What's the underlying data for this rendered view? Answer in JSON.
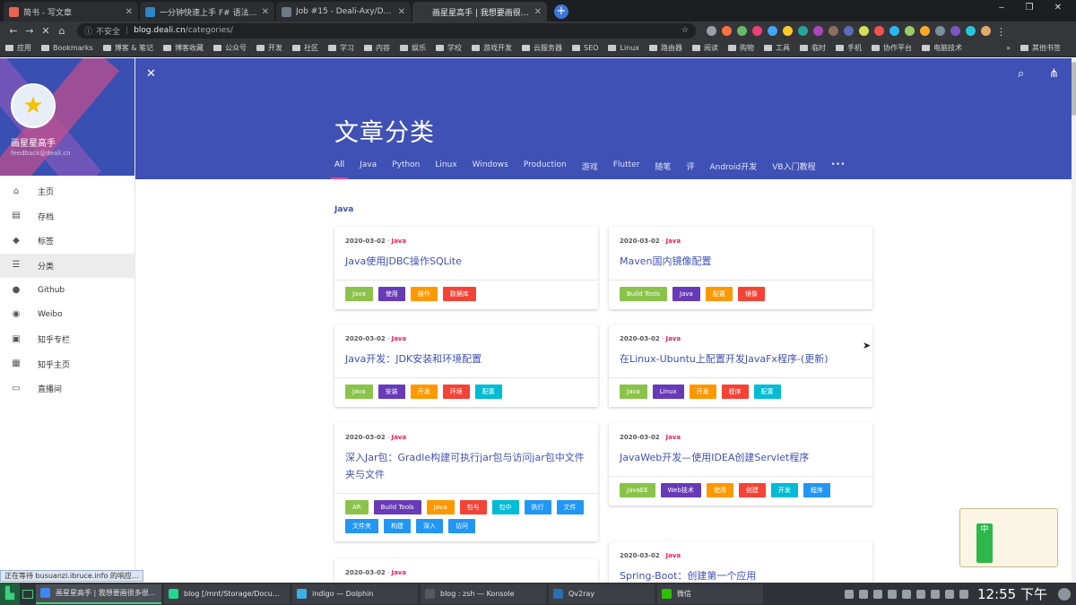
{
  "browser": {
    "tabs": [
      {
        "label": "简书 - 写文章",
        "icon": "jianshu-icon",
        "color": "#e9644f",
        "active": false
      },
      {
        "label": "一分钟快速上手 F# 语法 - 网上",
        "icon": "code-icon",
        "color": "#2d86c7",
        "active": false
      },
      {
        "label": "Job #15 - Deali-Axy/DealiAxy",
        "icon": "github-icon",
        "color": "#6c7a89",
        "active": false
      },
      {
        "label": "画星星高手 | 我想要画很多很",
        "icon": "blank-icon",
        "color": "#35363a",
        "active": true
      }
    ],
    "new_tab": "+",
    "window_controls": "‒ ❐ ✕",
    "address": {
      "insecure_label": "不安全",
      "host": "blog.deali.cn",
      "path": "/categories/"
    },
    "bookmarks": [
      "应用",
      "Bookmarks",
      "博客 & 笔记",
      "博客收藏",
      "公众号",
      "开发",
      "社区",
      "学习",
      "内容",
      "娱乐",
      "学校",
      "游戏开发",
      "云服务器",
      "SEO",
      "Linux",
      "路由器",
      "阅读",
      "购物",
      "工具",
      "临时",
      "手机",
      "协作平台",
      "电脑技术"
    ],
    "bookmarks_more": "»",
    "bookmarks_other": "其他书签"
  },
  "sidebar": {
    "name": "画星星高手",
    "email": "feedback@deali.cn",
    "menu": [
      {
        "label": "主页",
        "icon": "home-icon",
        "glyph": "⌂"
      },
      {
        "label": "存档",
        "icon": "archive-icon",
        "glyph": "▤"
      },
      {
        "label": "标签",
        "icon": "tag-icon",
        "glyph": "◆"
      },
      {
        "label": "分类",
        "icon": "list-icon",
        "glyph": "☰"
      },
      {
        "label": "Github",
        "icon": "github-icon",
        "glyph": "●"
      },
      {
        "label": "Weibo",
        "icon": "weibo-icon",
        "glyph": "◉"
      },
      {
        "label": "知乎专栏",
        "icon": "zhihu-column-icon",
        "glyph": "▣"
      },
      {
        "label": "知乎主页",
        "icon": "zhihu-profile-icon",
        "glyph": "▦"
      },
      {
        "label": "直播间",
        "icon": "monitor-icon",
        "glyph": "▭"
      }
    ],
    "active_index": 3
  },
  "header": {
    "close_glyph": "✕",
    "search_glyph": "⌕",
    "share_glyph": "⋔",
    "title": "文章分类",
    "tabs": [
      "All",
      "Java",
      "Python",
      "Linux",
      "Windows",
      "Production",
      "游戏",
      "Flutter",
      "随笔",
      "评",
      "Android开发",
      "VB入门教程",
      "•••"
    ],
    "active_tab": 0
  },
  "section": "Java",
  "posts": [
    {
      "date": "2020-03-02",
      "category": "Java",
      "title": "Java使用JDBC操作SQLite",
      "tags": [
        [
          "Java",
          "green"
        ],
        [
          "使用",
          "purple"
        ],
        [
          "操作",
          "orange"
        ],
        [
          "数据库",
          "red"
        ]
      ]
    },
    {
      "date": "2020-03-02",
      "category": "Java",
      "title": "Maven国内镜像配置",
      "tags": [
        [
          "Build Tools",
          "green"
        ],
        [
          "Java",
          "purple"
        ],
        [
          "配置",
          "orange"
        ],
        [
          "镜像",
          "red"
        ]
      ]
    },
    {
      "date": "2020-03-02",
      "category": "Java",
      "title": "Java开发：JDK安装和环境配置",
      "tags": [
        [
          "Java",
          "green"
        ],
        [
          "安装",
          "purple"
        ],
        [
          "开发",
          "orange"
        ],
        [
          "环境",
          "red"
        ],
        [
          "配置",
          "teal"
        ]
      ]
    },
    {
      "date": "2020-03-02",
      "category": "Java",
      "title": "在Linux-Ubuntu上配置开发JavaFx程序-(更新)",
      "tags": [
        [
          "Java",
          "green"
        ],
        [
          "Linux",
          "purple"
        ],
        [
          "开发",
          "orange"
        ],
        [
          "程序",
          "red"
        ],
        [
          "配置",
          "teal"
        ]
      ]
    },
    {
      "date": "2020-03-02",
      "category": "Java",
      "title": "深入Jar包：Gradle构建可执行jar包与访问jar包中文件夹与文件",
      "tags": [
        [
          "AR",
          "green"
        ],
        [
          "Build Tools",
          "purple"
        ],
        [
          "Java",
          "orange"
        ],
        [
          "包与",
          "red"
        ],
        [
          "包中",
          "teal"
        ],
        [
          "执行",
          "blue"
        ],
        [
          "文件",
          "blue"
        ],
        [
          "文件夹",
          "blue"
        ],
        [
          "构建",
          "blue"
        ],
        [
          "深入",
          "blue"
        ],
        [
          "访问",
          "blue"
        ]
      ]
    },
    {
      "date": "2020-03-02",
      "category": "Java",
      "title": "JavaWeb开发—使用IDEA创建Servlet程序",
      "tags": [
        [
          "JavaEE",
          "green"
        ],
        [
          "Web技术",
          "purple"
        ],
        [
          "使用",
          "orange"
        ],
        [
          "创建",
          "red"
        ],
        [
          "开发",
          "teal"
        ],
        [
          "程序",
          "blue"
        ]
      ]
    },
    {
      "date": "2020-03-02",
      "category": "Java",
      "title": "",
      "tags": []
    },
    {
      "date": "2020-03-02",
      "category": "Java",
      "title": "Spring-Boot：创建第一个应用",
      "tags": []
    }
  ],
  "status_message": "正在等待 busuanzi.ibruce.info 的响应...",
  "deco_label": "中",
  "taskbar": {
    "tasks": [
      {
        "label": "画星星高手 | 我想要画很多很...",
        "icon": "chrome-icon",
        "color": "#4285f4",
        "active": true
      },
      {
        "label": "blog [/mnt/Storage/Docume...",
        "icon": "pycharm-icon",
        "color": "#21d789",
        "active": false
      },
      {
        "label": "indigo — Dolphin",
        "icon": "dolphin-icon",
        "color": "#3daee9",
        "active": false
      },
      {
        "label": "blog : zsh — Konsole",
        "icon": "konsole-icon",
        "color": "#555a60",
        "active": false
      },
      {
        "label": "Qv2ray",
        "icon": "qv2ray-icon",
        "color": "#2a6fb0",
        "active": false
      },
      {
        "label": "微信",
        "icon": "wechat-icon",
        "color": "#2dc100",
        "active": false
      }
    ],
    "clock": "12:55 下午"
  }
}
